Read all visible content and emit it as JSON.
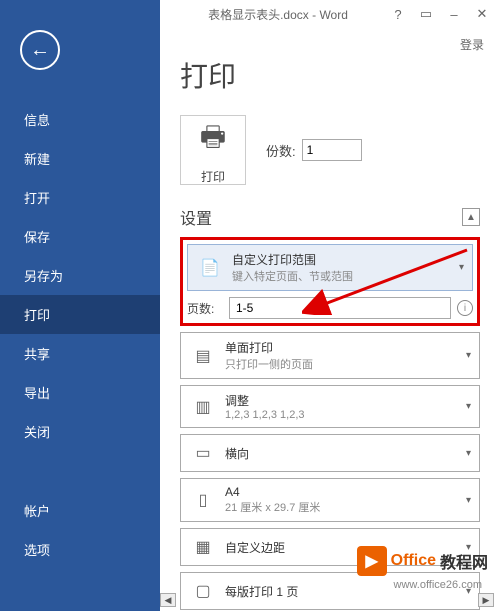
{
  "titlebar": {
    "title": "表格显示表头.docx - Word",
    "help": "?",
    "windowMenu": "▭",
    "minimize": "–",
    "close": "✕"
  },
  "login": "登录",
  "sidebar": {
    "items": [
      "信息",
      "新建",
      "打开",
      "保存",
      "另存为",
      "打印",
      "共享",
      "导出",
      "关闭",
      "帐户",
      "选项"
    ]
  },
  "main": {
    "pageTitle": "打印",
    "printLabel": "打印",
    "copiesLabel": "份数:",
    "copiesValue": "1",
    "settingsTitle": "设置",
    "scrollUp": "▲",
    "scrollDown": "▼",
    "pagesLabel": "页数:",
    "pagesValue": "1-5",
    "settings": [
      {
        "title": "自定义打印范围",
        "sub": "键入特定页面、节或范围"
      },
      {
        "title": "单面打印",
        "sub": "只打印一侧的页面"
      },
      {
        "title": "调整",
        "sub": "1,2,3    1,2,3    1,2,3"
      },
      {
        "title": "横向",
        "sub": ""
      },
      {
        "title": "A4",
        "sub": "21 厘米 x 29.7 厘米"
      },
      {
        "title": "自定义边距",
        "sub": ""
      },
      {
        "title": "每版打印 1 页",
        "sub": ""
      }
    ]
  },
  "watermark": {
    "brand1": "Office",
    "brand2": "教程网",
    "url": "www.office26.com"
  }
}
